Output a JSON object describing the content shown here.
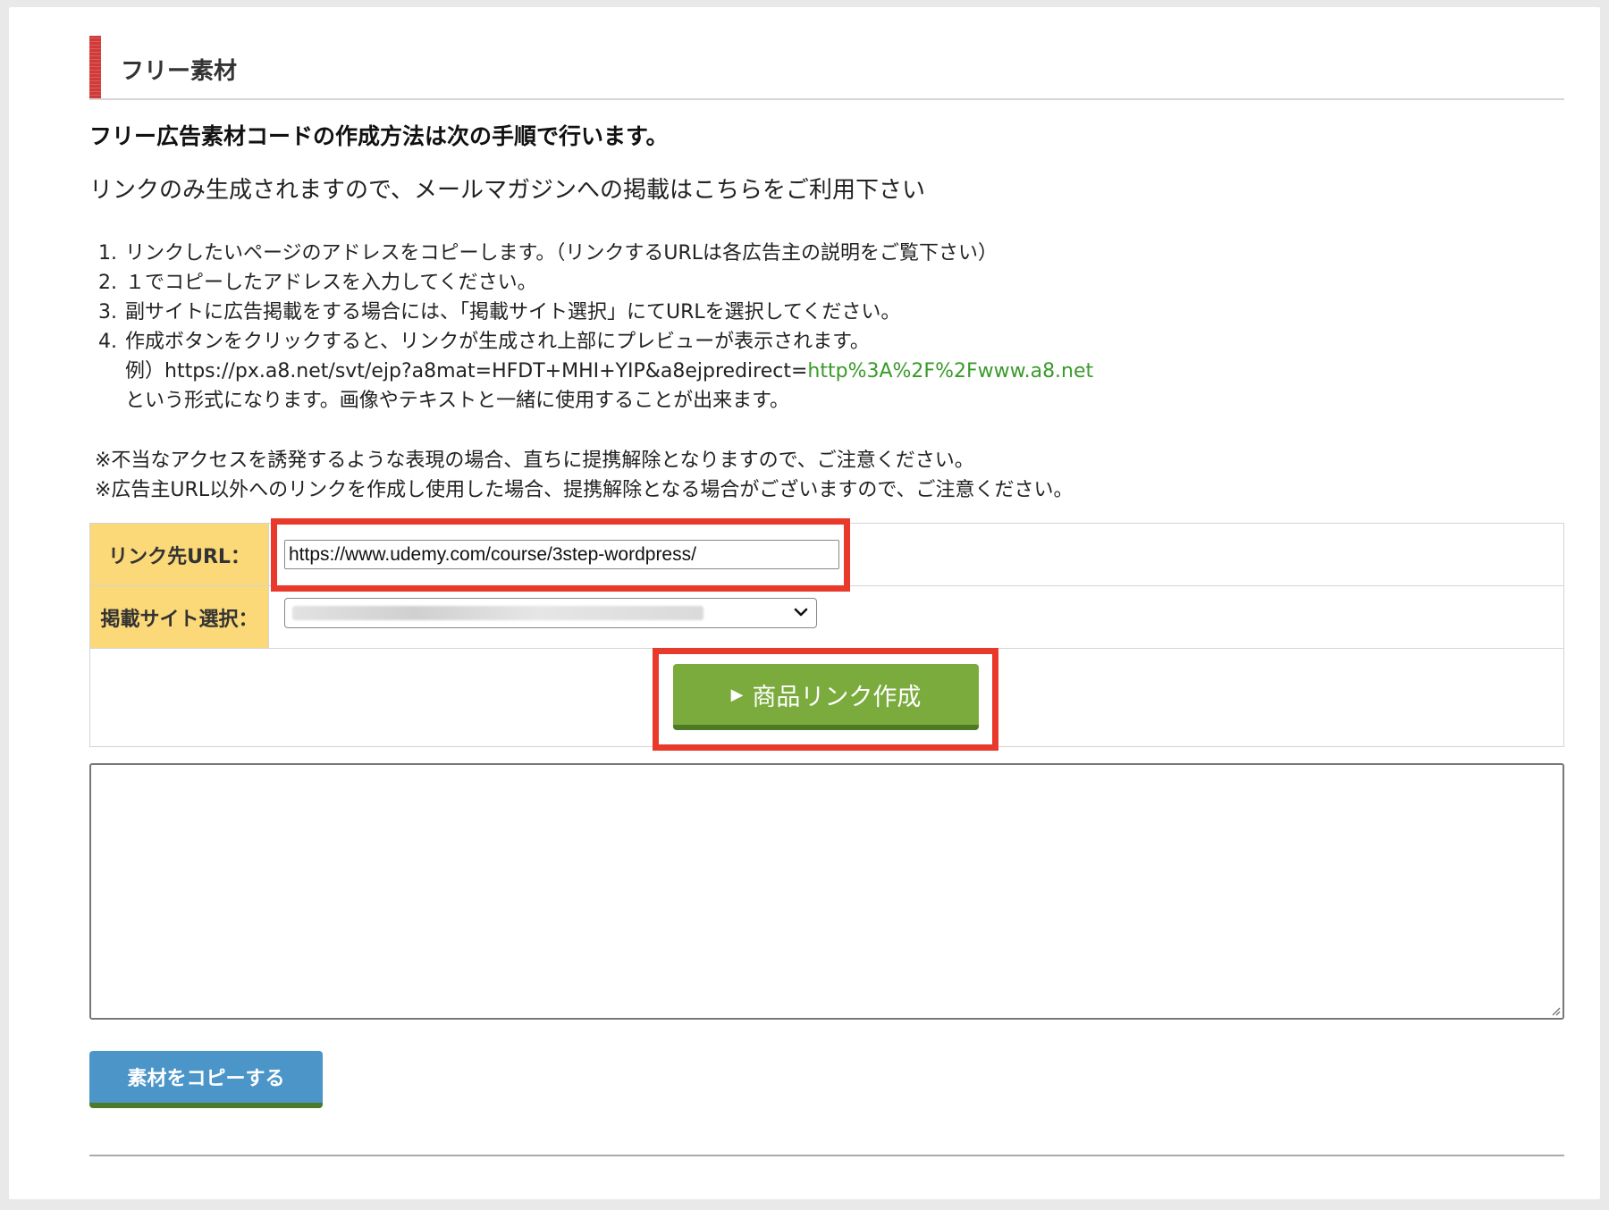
{
  "section": {
    "title": "フリー素材"
  },
  "heading": "フリー広告素材コードの作成方法は次の手順で行います。",
  "subtext": "リンクのみ生成されますので、メールマガジンへの掲載はこちらをご利用下さい",
  "steps": [
    {
      "num": "1.",
      "text": "リンクしたいページのアドレスをコピーします。（リンクするURLは各広告主の説明をご覧下さい）"
    },
    {
      "num": "2.",
      "text": "１でコピーしたアドレスを入力してください。"
    },
    {
      "num": "3.",
      "text": "副サイトに広告掲載をする場合には、「掲載サイト選択」にてURLを選択してください。"
    },
    {
      "num": "4.",
      "text": "作成ボタンをクリックすると、リンクが生成され上部にプレビューが表示されます。"
    }
  ],
  "example": {
    "prefix": "例）https://px.a8.net/svt/ejp?a8mat=HFDT+MHI+YIP&a8ejpredirect=",
    "link": "http%3A%2F%2Fwww.a8.net",
    "note": "という形式になります。画像やテキストと一緒に使用することが出来ます。"
  },
  "notes": [
    "※不当なアクセスを誘発するような表現の場合、直ちに提携解除となりますので、ご注意ください。",
    "※広告主URL以外へのリンクを作成し使用した場合、提携解除となる場合がございますので、ご注意ください。"
  ],
  "form": {
    "url_label": "リンク先URL：",
    "url_value": "https://www.udemy.com/course/3step-wordpress/",
    "site_label": "掲載サイト選択：",
    "create_button": "商品リンク作成",
    "create_icon": "play-triangle-icon"
  },
  "copy_button": "素材をコピーする",
  "colors": {
    "accent_red": "#e8392a",
    "label_yellow": "#fbd878",
    "button_green": "#7aab3c",
    "button_blue": "#4b95c8",
    "link_green": "#3a9a2a"
  }
}
